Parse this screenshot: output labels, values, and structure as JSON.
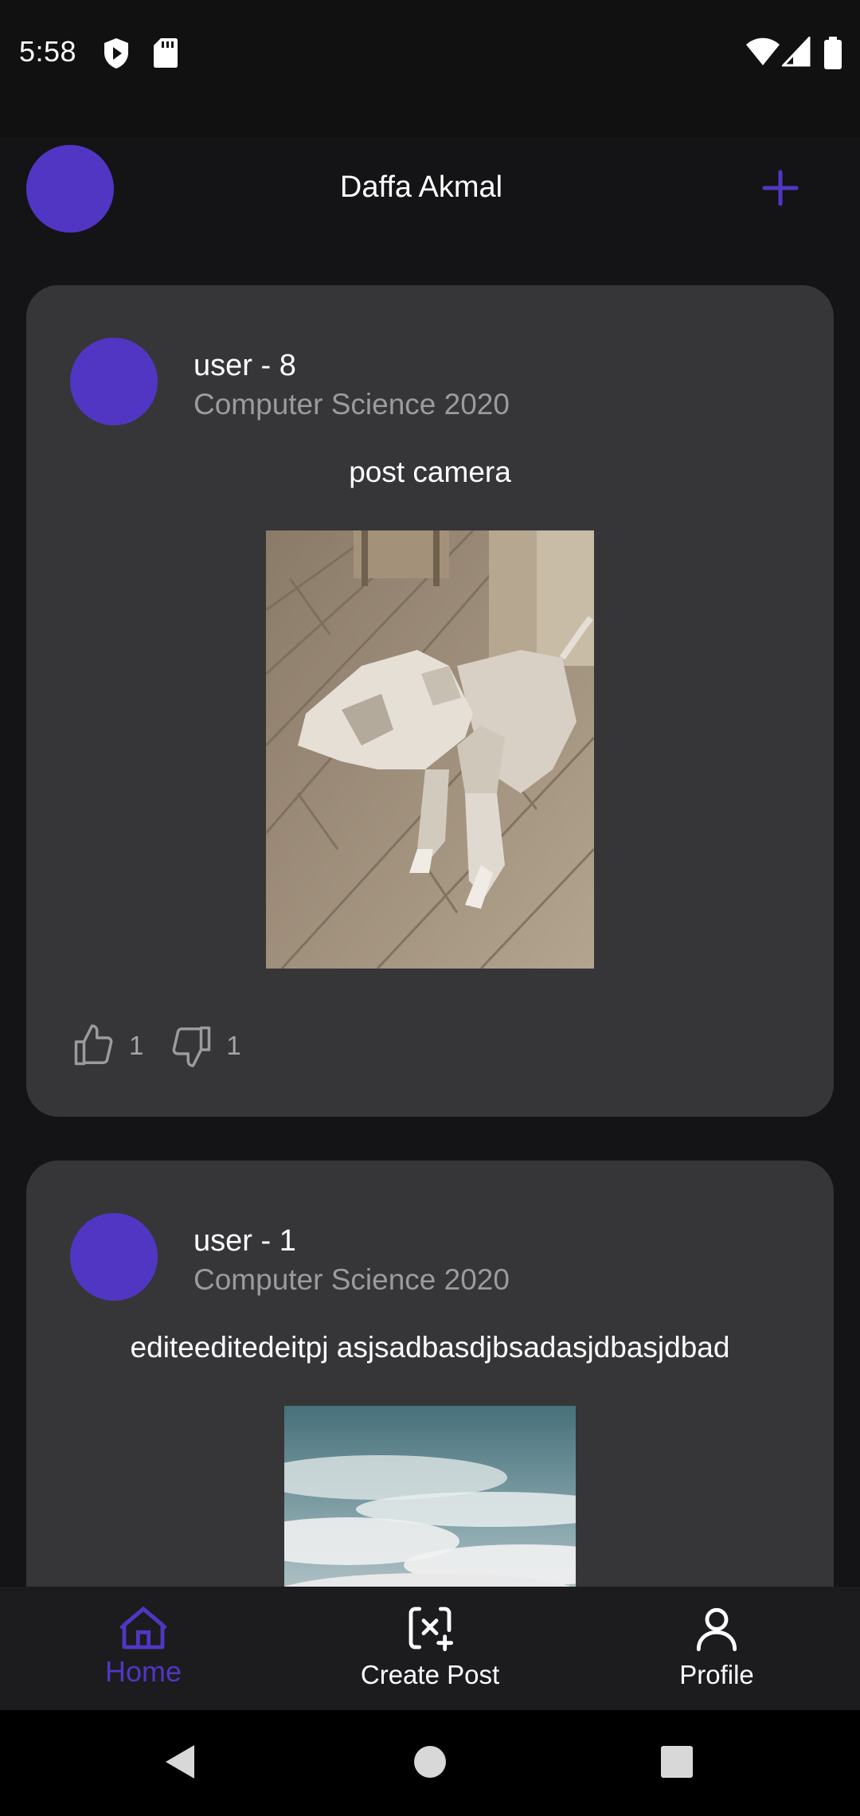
{
  "status_bar": {
    "time": "5:58",
    "left_icons": [
      "shield-play-icon",
      "sd-card-icon"
    ],
    "right_icons": [
      "wifi-icon",
      "cell-signal-icon",
      "battery-icon"
    ]
  },
  "app_bar": {
    "title": "Daffa Akmal",
    "add_icon": "plus-icon",
    "accent": "#5136c4"
  },
  "posts": [
    {
      "username": "user - 8",
      "major": "Computer Science 2020",
      "text": "post camera",
      "image": "photo of a low-poly dog on a wooden floor",
      "likes": "1",
      "dislikes": "1"
    },
    {
      "username": "user - 1",
      "major": "Computer Science 2020",
      "text": "editeeditedeitpj asjsadbasdjbsadasjdbasjdbad",
      "image": "photo of a cloudy sky"
    }
  ],
  "bottom_nav": {
    "items": [
      {
        "label": "Home",
        "icon": "home-icon",
        "active": true
      },
      {
        "label": "Create Post",
        "icon": "create-post-icon",
        "active": false
      },
      {
        "label": "Profile",
        "icon": "profile-icon",
        "active": false
      }
    ],
    "active_color": "#5136c4"
  },
  "system_nav": {
    "buttons": [
      "back-icon",
      "home-circle-icon",
      "recents-icon"
    ]
  }
}
